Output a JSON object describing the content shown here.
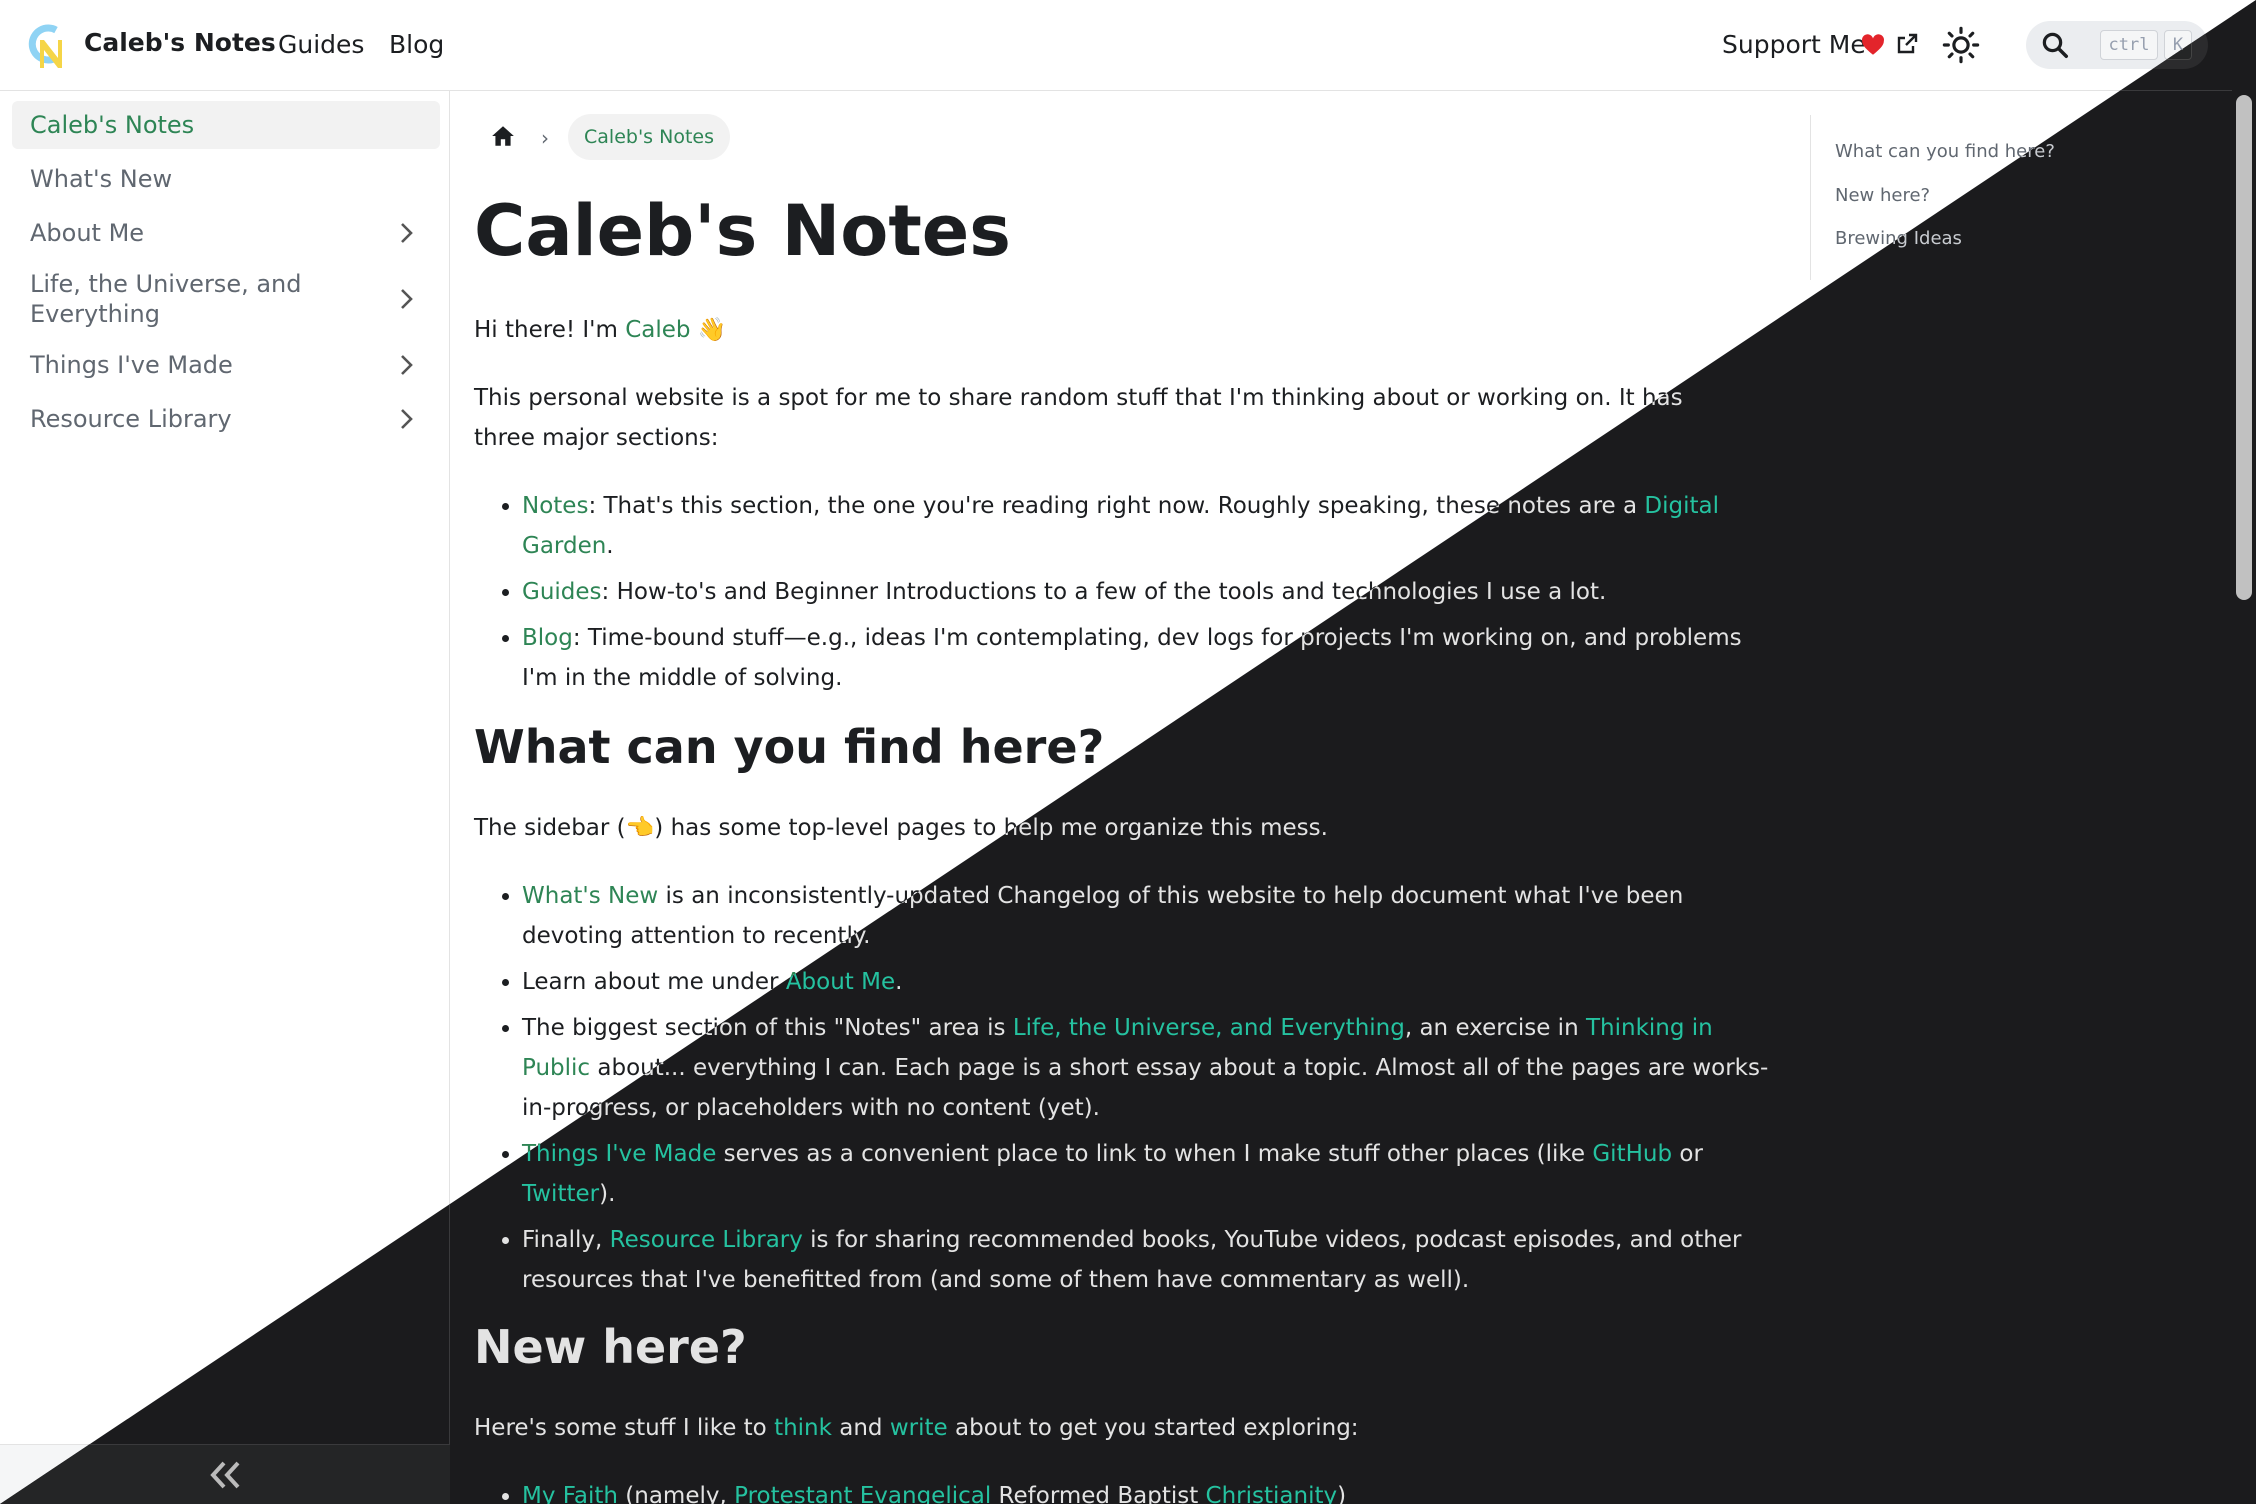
{
  "navbar": {
    "brand": "Caleb's Notes",
    "links": [
      "Guides",
      "Blog"
    ],
    "support": "Support Me",
    "search_keys": [
      "ctrl",
      "K"
    ]
  },
  "sidebar": {
    "items": [
      {
        "label": "Caleb's Notes",
        "active": true,
        "chevron": false
      },
      {
        "label": "What's New",
        "active": false,
        "chevron": false
      },
      {
        "label": "About Me",
        "active": false,
        "chevron": true
      },
      {
        "label": "Life, the Universe, and Everything",
        "active": false,
        "chevron": true
      },
      {
        "label": "Things I've Made",
        "active": false,
        "chevron": true
      },
      {
        "label": "Resource Library",
        "active": false,
        "chevron": true
      }
    ]
  },
  "breadcrumb": {
    "current": "Caleb's Notes"
  },
  "article": {
    "title": "Caleb's Notes",
    "intro_pre": "Hi there! I'm ",
    "intro_link": "Caleb",
    "intro_emoji": "👋",
    "para1": "This personal website is a spot for me to share random stuff that I'm thinking about or working on. It has three major sections:",
    "sections": [
      {
        "link": "Notes",
        "text": ": That's this section, the one you're reading right now. Roughly speaking, these notes are a ",
        "link2": "Digital Garden",
        "text2": "."
      },
      {
        "link": "Guides",
        "text": ": How-to's and Beginner Introductions to a few of the tools and technologies I use a lot.",
        "link2": "",
        "text2": ""
      },
      {
        "link": "Blog",
        "text": ": Time-bound stuff—e.g., ideas I'm contemplating, dev logs for projects I'm working on, and problems I'm in the middle of solving.",
        "link2": "",
        "text2": ""
      }
    ],
    "h2_find": "What can you find here?",
    "sidebar_pre": "The sidebar (",
    "sidebar_emoji": "👈",
    "sidebar_post": ") has some top-level pages to help me organize this mess.",
    "find_items": {
      "whats_new_link": "What's New",
      "whats_new_text": " is an inconsistently-updated Changelog of this website to help document what I've been devoting attention to recently.",
      "about_pre": "Learn about me under ",
      "about_link": "About Me",
      "about_post": ".",
      "biggest_pre": "The biggest section of this \"Notes\" area is ",
      "biggest_link": "Life, the Universe, and Everything",
      "biggest_mid": ", an exercise in ",
      "biggest_link2": "Thinking in Public",
      "biggest_post": " about... everything I can. Each page is a short essay about a topic. Almost all of the pages are works-in-progress, or placeholders with no content (yet).",
      "things_link": "Things I've Made",
      "things_mid": " serves as a convenient place to link to when I make stuff other places (like ",
      "things_link2": "GitHub",
      "things_or": " or ",
      "things_link3": "Twitter",
      "things_post": ").",
      "finally_pre": "Finally, ",
      "finally_link": "Resource Library",
      "finally_post": " is for sharing recommended books, YouTube videos, podcast episodes, and other resources that I've benefitted from (and some of them have commentary as well)."
    },
    "h2_new": "New here?",
    "new_pre": "Here's some stuff I like to ",
    "new_link1": "think",
    "new_and": " and ",
    "new_link2": "write",
    "new_post": " about to get you started exploring:",
    "faith": {
      "link1": "My Faith",
      "t1": " (namely, ",
      "link2": "Protestant Evangelical",
      "t2": " Reformed Baptist ",
      "link3": "Christianity",
      "t3": ")"
    }
  },
  "toc": [
    "What can you find here?",
    "New here?",
    "Brewing Ideas"
  ],
  "colors": {
    "light_link": "#2e8555",
    "dark_link": "#25c2a0",
    "dark_bg": "#1b1b1d"
  }
}
